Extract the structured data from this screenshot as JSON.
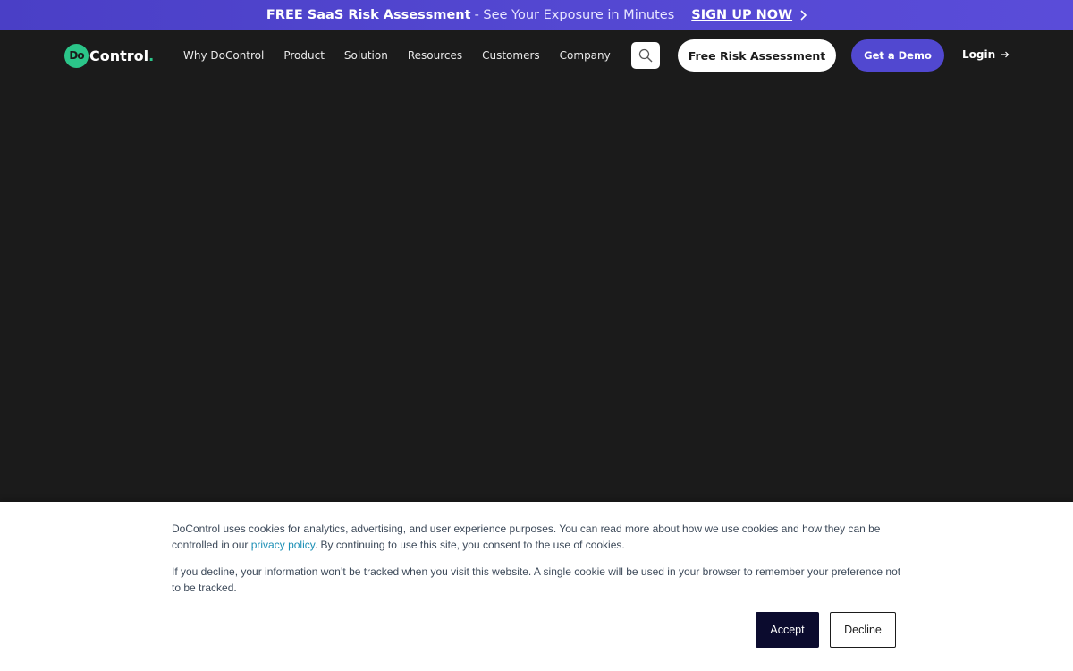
{
  "announcement": {
    "bold_text": "FREE SaaS Risk Assessment",
    "rest_text": "- See Your Exposure in Minutes",
    "cta_label": "SIGN UP NOW"
  },
  "nav": {
    "logo": {
      "mark": "Do",
      "word": "Control",
      "dot": "."
    },
    "menu": [
      "Why DoControl",
      "Product",
      "Solution",
      "Resources",
      "Customers",
      "Company"
    ],
    "free_risk_label": "Free Risk Assessment",
    "demo_label": "Get a Demo",
    "login_label": "Login"
  },
  "cookie_banner": {
    "p1_before": "DoControl uses cookies for analytics, advertising, and user experience purposes. You can read more about how we use cookies and how they can be controlled in our ",
    "p1_link": "privacy policy",
    "p1_after": ". By continuing to use this site, you consent to the use of cookies.",
    "p2": "If you decline, your information won’t be tracked when you visit this website. A single cookie will be used in your browser to remember your preference not to be tracked.",
    "accept_label": "Accept",
    "decline_label": "Decline"
  },
  "colors": {
    "announcement_bg": "#5448d2",
    "nav_bg": "#1b1b1b",
    "brand_green": "#2bc589",
    "demo_button": "#5148d0",
    "accept_button": "#0b0b2e",
    "link": "#1c8fb5"
  }
}
